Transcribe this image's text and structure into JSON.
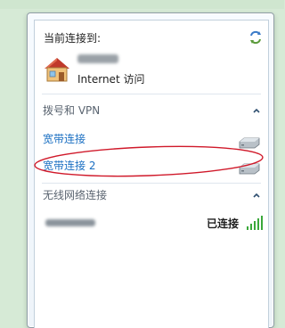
{
  "header": {
    "title": "当前连接到:",
    "network_access": "Internet 访问"
  },
  "dialup_section": {
    "title": "拨号和 VPN",
    "items": [
      {
        "label": "宽带连接"
      },
      {
        "label": "宽带连接 2"
      }
    ]
  },
  "wireless_section": {
    "title": "无线网络连接",
    "network": {
      "status": "已连接"
    }
  },
  "colors": {
    "link": "#1a6fc2",
    "annotation": "#d0192a",
    "signal": "#3aa83a"
  },
  "icons": {
    "refresh": "refresh-icon",
    "network": "home-network-icon",
    "collapse": "chevron-up-icon",
    "modem": "modem-icon",
    "signal": "signal-strength-icon"
  }
}
